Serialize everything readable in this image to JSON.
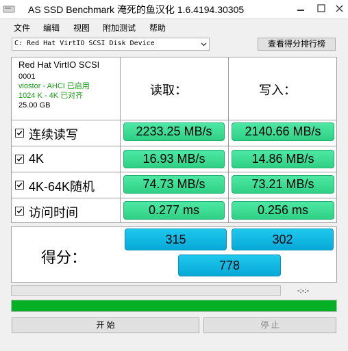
{
  "window": {
    "title": "AS SSD Benchmark 淹死的鱼汉化 1.6.4194.30305"
  },
  "menu": [
    "文件",
    "编辑",
    "视图",
    "附加测试",
    "帮助"
  ],
  "drive_select": {
    "value": "C: Red Hat VirtIO SCSI Disk Device"
  },
  "ranking_button": "查看得分排行榜",
  "drive_info": {
    "name": "Red Hat VirtIO SCSI",
    "firmware": "0001",
    "driver": "viostor - AHCI 已启用",
    "alignment": "1024 K - 4K 已对齐",
    "size": "25.00 GB"
  },
  "headers": {
    "read": "读取：",
    "write": "写入："
  },
  "rows": [
    {
      "label": "连续读写",
      "checked": true,
      "read": "2233.25 MB/s",
      "write": "2140.66 MB/s"
    },
    {
      "label": "4K",
      "checked": true,
      "read": "16.93 MB/s",
      "write": "14.86 MB/s"
    },
    {
      "label": "4K-64K随机",
      "checked": true,
      "read": "74.73 MB/s",
      "write": "73.21 MB/s"
    },
    {
      "label": "访问时间",
      "checked": true,
      "read": "0.277 ms",
      "write": "0.256 ms"
    }
  ],
  "score": {
    "label": "得分：",
    "read": "315",
    "write": "302",
    "total": "778"
  },
  "elapsed": "-:-:-",
  "progress": {
    "test": 0,
    "overall": 1.0
  },
  "buttons": {
    "start": "开 始",
    "stop": "停 止"
  },
  "colors": {
    "result": "#38d98f",
    "score": "#12b8e2",
    "progress": "#06b025"
  }
}
